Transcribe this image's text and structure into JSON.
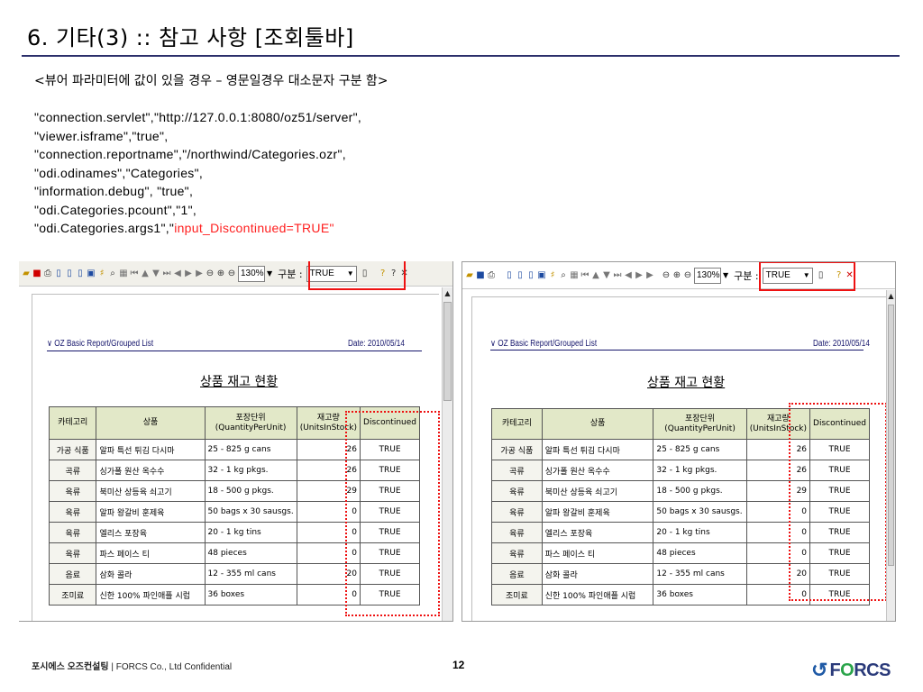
{
  "slide": {
    "title": "6. 기타(3) :: 참고 사항 [조회툴바]",
    "subtitle": "<뷰어 파라미터에 값이 있을 경우 – 영문일경우 대소문자 구분 함>",
    "code_lines": [
      "\"connection.servlet\",\"http://127.0.0.1:8080/oz51/server\",",
      "\"viewer.isframe\",\"true\",",
      "\"connection.reportname\",\"/northwind/Categories.ozr\",",
      "\"odi.odinames\",\"Categories\",",
      "\"information.debug\", \"true\",",
      "\"odi.Categories.pcount\",\"1\","
    ],
    "code_last_prefix": "\"odi.Categories.args1\",\"",
    "code_last_highlight": "input_Discontinued=TRUE\"",
    "highlight_color": "#ff1e1e"
  },
  "viewer_left": {
    "zoom": "130%",
    "filter_label": "구분 :",
    "filter_value": "TRUE",
    "report_header_left": "∨ OZ Basic Report/Grouped List",
    "report_header_right": "Date: 2010/05/14",
    "report_title": "상품 재고 현황"
  },
  "viewer_right": {
    "zoom": "130%",
    "filter_label": "구분 :",
    "filter_value": "TRUE",
    "report_header_left": "∨ OZ Basic Report/Grouped List",
    "report_header_right": "Date: 2010/05/14",
    "report_title": "상품 재고 현황"
  },
  "table": {
    "headers": [
      "카테고리",
      "상품",
      "포장단위\n(QuantityPerUnit)",
      "재고량\n(UnitsInStock)",
      "Discontinued"
    ],
    "rows": [
      [
        "가공 식품",
        "알파 특선 튀김 다시마",
        "25 - 825 g cans",
        "26",
        "TRUE"
      ],
      [
        "곡류",
        "싱가폴 원산 옥수수",
        "32 - 1 kg pkgs.",
        "26",
        "TRUE"
      ],
      [
        "육류",
        "북미산 상등육 쇠고기",
        "18 - 500 g pkgs.",
        "29",
        "TRUE"
      ],
      [
        "육류",
        "알파 왕갈비 훈제육",
        "50 bags x 30 sausgs.",
        "0",
        "TRUE"
      ],
      [
        "육류",
        "엘리스 포장육",
        "20 - 1 kg tins",
        "0",
        "TRUE"
      ],
      [
        "육류",
        "파스 페이스 티",
        "48 pieces",
        "0",
        "TRUE"
      ],
      [
        "음료",
        "삼화 콜라",
        "12 - 355 ml cans",
        "20",
        "TRUE"
      ],
      [
        "조미료",
        "신한 100% 파인애플 시럽",
        "36 boxes",
        "0",
        "TRUE"
      ]
    ]
  },
  "footer": {
    "company_ko": "포시에스 오즈컨설팅",
    "separator": " | ",
    "company_en": "FORCS Co., Ltd Confidential",
    "page_number": "12",
    "logo_text_pre": "F",
    "logo_text_o": "O",
    "logo_text_post": "RCS",
    "logo_color": "#1f5aa6"
  }
}
